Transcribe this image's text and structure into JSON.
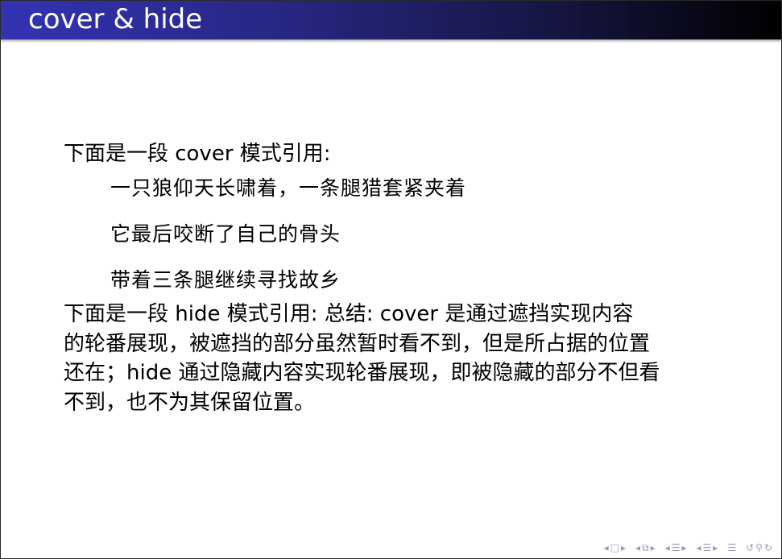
{
  "slide": {
    "title": "cover & hide",
    "intro_cover": "下面是一段 cover 模式引用:",
    "quote_lines": [
      "一只狼仰天长啸着，一条腿猎套紧夹着",
      "它最后咬断了自己的骨头",
      "带着三条腿继续寻找故乡"
    ],
    "summary_lines": [
      "下面是一段 hide 模式引用:  总结: cover 是通过遮挡实现内容",
      "的轮番展现，被遮挡的部分虽然暂时看不到，但是所占据的位置",
      "还在；hide 通过隐藏内容实现轮番展现，即被隐藏的部分不但看",
      "不到，也不为其保留位置。"
    ]
  },
  "navigation": {
    "color": "#9a9ab8",
    "icons": {
      "frame_prev": "◂",
      "frame": "□",
      "frame_next": "▸",
      "subsection_prev": "◂",
      "subsection": "⧉",
      "subsection_next": "▸",
      "section_prev": "◂",
      "section": "☰",
      "section_next": "▸",
      "doc_prev": "◂",
      "doc": "☰",
      "doc_next": "▸",
      "outline": "☰",
      "back": "↺",
      "search": "⚲",
      "forward": "↻"
    }
  }
}
